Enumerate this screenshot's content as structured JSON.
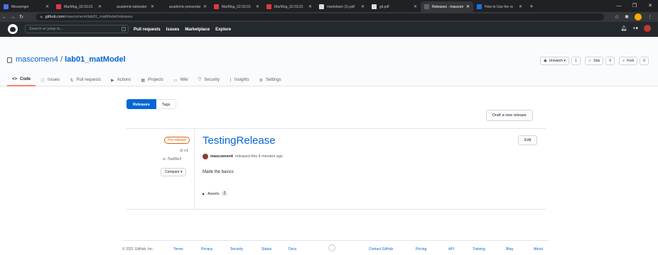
{
  "browser": {
    "tabs": [
      {
        "title": "Messenger",
        "color": "#4b6ef5"
      },
      {
        "title": "MarMoд_02.03.01",
        "color": "#e0383e"
      },
      {
        "title": "academic-laborator",
        "color": "#202124"
      },
      {
        "title": "academic-presentat",
        "color": "#202124"
      },
      {
        "title": "MarMoд_02.03.01",
        "color": "#e0383e"
      },
      {
        "title": "MarMoд_02.03.01",
        "color": "#e0383e"
      },
      {
        "title": "markdown (1).pdf",
        "color": "#dadce0"
      },
      {
        "title": "git.pdf",
        "color": "#dadce0"
      },
      {
        "title": "Releases · mascom",
        "color": "#5f6368",
        "active": true
      },
      {
        "title": "How to Use the re",
        "color": "#1a73e8"
      }
    ],
    "url_host": "github.com",
    "url_path": "/mascomen4/lab01_matModel/releases"
  },
  "github_header": {
    "search_placeholder": "Search or jump to...",
    "slash_key": "/",
    "nav": [
      "Pull requests",
      "Issues",
      "Marketplace",
      "Explore"
    ]
  },
  "repo": {
    "owner": "mascomen4",
    "separator": "/",
    "name": "lab01_matModel",
    "watch_label": "Unwatch ▾",
    "watch_count": "1",
    "star_label": "Star",
    "star_count": "0",
    "fork_label": "Fork",
    "fork_count": "0",
    "tabs": [
      {
        "label": "Code",
        "icon": "<>",
        "active": true
      },
      {
        "label": "Issues",
        "icon": "ⓘ"
      },
      {
        "label": "Pull requests",
        "icon": "⇅"
      },
      {
        "label": "Actions",
        "icon": "▶"
      },
      {
        "label": "Projects",
        "icon": "▦"
      },
      {
        "label": "Wiki",
        "icon": "▭"
      },
      {
        "label": "Security",
        "icon": "⛉"
      },
      {
        "label": "Insights",
        "icon": "⌇"
      },
      {
        "label": "Settings",
        "icon": "⚙"
      }
    ]
  },
  "releases_page": {
    "releases_tab": "Releases",
    "tags_tab": "Tags",
    "draft_button": "Draft a new release"
  },
  "release": {
    "badge": "Pre-release",
    "tag": "v1",
    "commit": "7be85e4",
    "compare_label": "Compare ▾",
    "title": "TestingRelease",
    "edit_label": "Edit",
    "author": "mascomen4",
    "meta": "released this 4 minutes ago",
    "body": "Made the basics",
    "assets_label": "Assets",
    "assets_count": "2"
  },
  "footer": {
    "copyright": "© 2021 GitHub, Inc.",
    "links": [
      "Terms",
      "Privacy",
      "Security",
      "Status",
      "Docs",
      "Contact GitHub",
      "Pricing",
      "API",
      "Training",
      "Blog",
      "About"
    ]
  }
}
